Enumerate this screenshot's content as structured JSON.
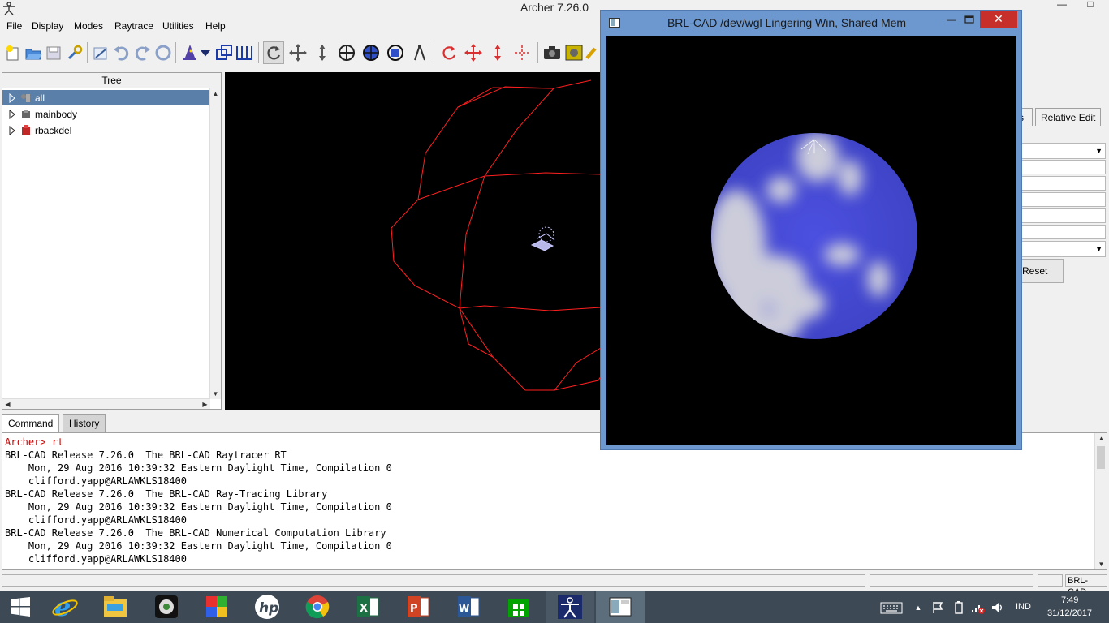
{
  "app": {
    "title": "Archer 7.26.0",
    "controls": {
      "minimize": "—",
      "maximize": "□"
    }
  },
  "menu": [
    "File",
    "Display",
    "Modes",
    "Raytrace",
    "Utilities",
    "Help"
  ],
  "toolbar_icons": [
    "new-database-icon",
    "open-database-icon",
    "save-database-icon",
    "preferences-icon",
    "edit-icon",
    "undo-icon",
    "redo-icon",
    "revert-icon",
    "wizard-icon",
    "more-icon",
    "copy-icon",
    "combination-icon",
    "rotate-view-icon",
    "translate-view-icon",
    "scale-view-icon",
    "center-view-icon",
    "component-pick-icon",
    "measure-icon",
    "compass-icon",
    "rotate-object-icon",
    "translate-object-icon",
    "scale-object-icon",
    "center-object-icon",
    "raytrace-camera-icon",
    "framebuffer-icon",
    "clear-icon"
  ],
  "tree": {
    "header": "Tree",
    "items": [
      {
        "label": "all",
        "icon": "assembly-icon",
        "selected": true
      },
      {
        "label": "mainbody",
        "icon": "combination-icon",
        "selected": false
      },
      {
        "label": "rbackdel",
        "icon": "region-icon",
        "selected": false
      }
    ]
  },
  "right_panel": {
    "tab_partial": "s",
    "tab_relative_edit": "Relative Edit",
    "reset_label": "Reset"
  },
  "command": {
    "tabs": [
      "Command",
      "History"
    ],
    "prompt": "Archer> ",
    "entered": "rt",
    "output": [
      "BRL-CAD Release 7.26.0  The BRL-CAD Raytracer RT",
      "    Mon, 29 Aug 2016 10:39:32 Eastern Daylight Time, Compilation 0",
      "    clifford.yapp@ARLAWKLS18400",
      "BRL-CAD Release 7.26.0  The BRL-CAD Ray-Tracing Library",
      "    Mon, 29 Aug 2016 10:39:32 Eastern Daylight Time, Compilation 0",
      "    clifford.yapp@ARLAWKLS18400",
      "BRL-CAD Release 7.26.0  The BRL-CAD Numerical Computation Library",
      "    Mon, 29 Aug 2016 10:39:32 Eastern Daylight Time, Compilation 0",
      "    clifford.yapp@ARLAWKLS18400"
    ]
  },
  "status": {
    "right_label": "BRL-CAD"
  },
  "rt_window": {
    "title": "BRL-CAD /dev/wgl Lingering Win, Shared Mem",
    "close": "✕",
    "minimize": "—"
  },
  "taskbar": {
    "apps": [
      "start-icon",
      "internet-explorer-icon",
      "file-explorer-icon",
      "media-icon",
      "paint-icon",
      "hp-icon",
      "chrome-icon",
      "excel-icon",
      "powerpoint-icon",
      "word-icon",
      "store-icon",
      "archer-icon",
      "framebuffer-window-icon"
    ],
    "tray": {
      "language": "IND",
      "time": "7:49",
      "date": "31/12/2017"
    }
  },
  "colors": {
    "wireframe": "#ff2020",
    "sphere_blue": "#4a52d8",
    "selection": "#5a7fa8",
    "close_button": "#c7302a",
    "rt_frame": "#6d98cf",
    "taskbar": "#3d4955"
  }
}
